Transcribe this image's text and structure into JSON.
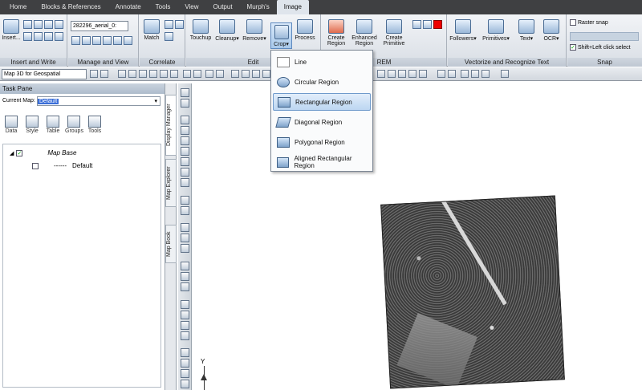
{
  "tabs": [
    "Home",
    "Blocks & References",
    "Annotate",
    "Tools",
    "View",
    "Output",
    "Murph's",
    "Image"
  ],
  "active_tab": "Image",
  "panels": {
    "insert_write": {
      "label": "Insert and Write",
      "insert_btn": "Insert..."
    },
    "manage_view": {
      "label": "Manage and View",
      "image_combo": "282296_aerial_0:"
    },
    "correlate": {
      "label": "Correlate",
      "match_btn": "Match"
    },
    "edit": {
      "label": "Edit",
      "touchup": "Touchup",
      "cleanup": "Cleanup",
      "remove": "Remove",
      "crop": "Crop",
      "process": "Process"
    },
    "rem": {
      "label": "REM",
      "create_region": "Create Region",
      "enhanced_region": "Enhanced Region",
      "create_primitive": "Create Primitive"
    },
    "vectorize": {
      "label": "Vectorize and Recognize Text",
      "followers": "Followers",
      "primitives": "Primitives",
      "text": "Text",
      "ocr": "OCR"
    },
    "snap": {
      "label": "Snap",
      "raster_snap": "Raster snap",
      "shift_click": "Shift+Left click select"
    }
  },
  "workspace_combo": "Map 3D for Geospatial",
  "crop_menu": {
    "items": [
      "Line",
      "Circular Region",
      "Rectangular Region",
      "Diagonal Region",
      "Polygonal Region",
      "Aligned Rectangular Region"
    ],
    "highlighted": "Rectangular Region"
  },
  "task_pane": {
    "title": "Task Pane",
    "current_map_label": "Current Map:",
    "current_map_value": "Default",
    "icons": [
      "Data",
      "Style",
      "Table",
      "Groups",
      "Tools"
    ],
    "tree": {
      "root": "Map Base",
      "child": "Default"
    }
  },
  "side_tabs": [
    "Display Manager",
    "Map Explorer",
    "Map Book"
  ],
  "axis_label": "Y"
}
